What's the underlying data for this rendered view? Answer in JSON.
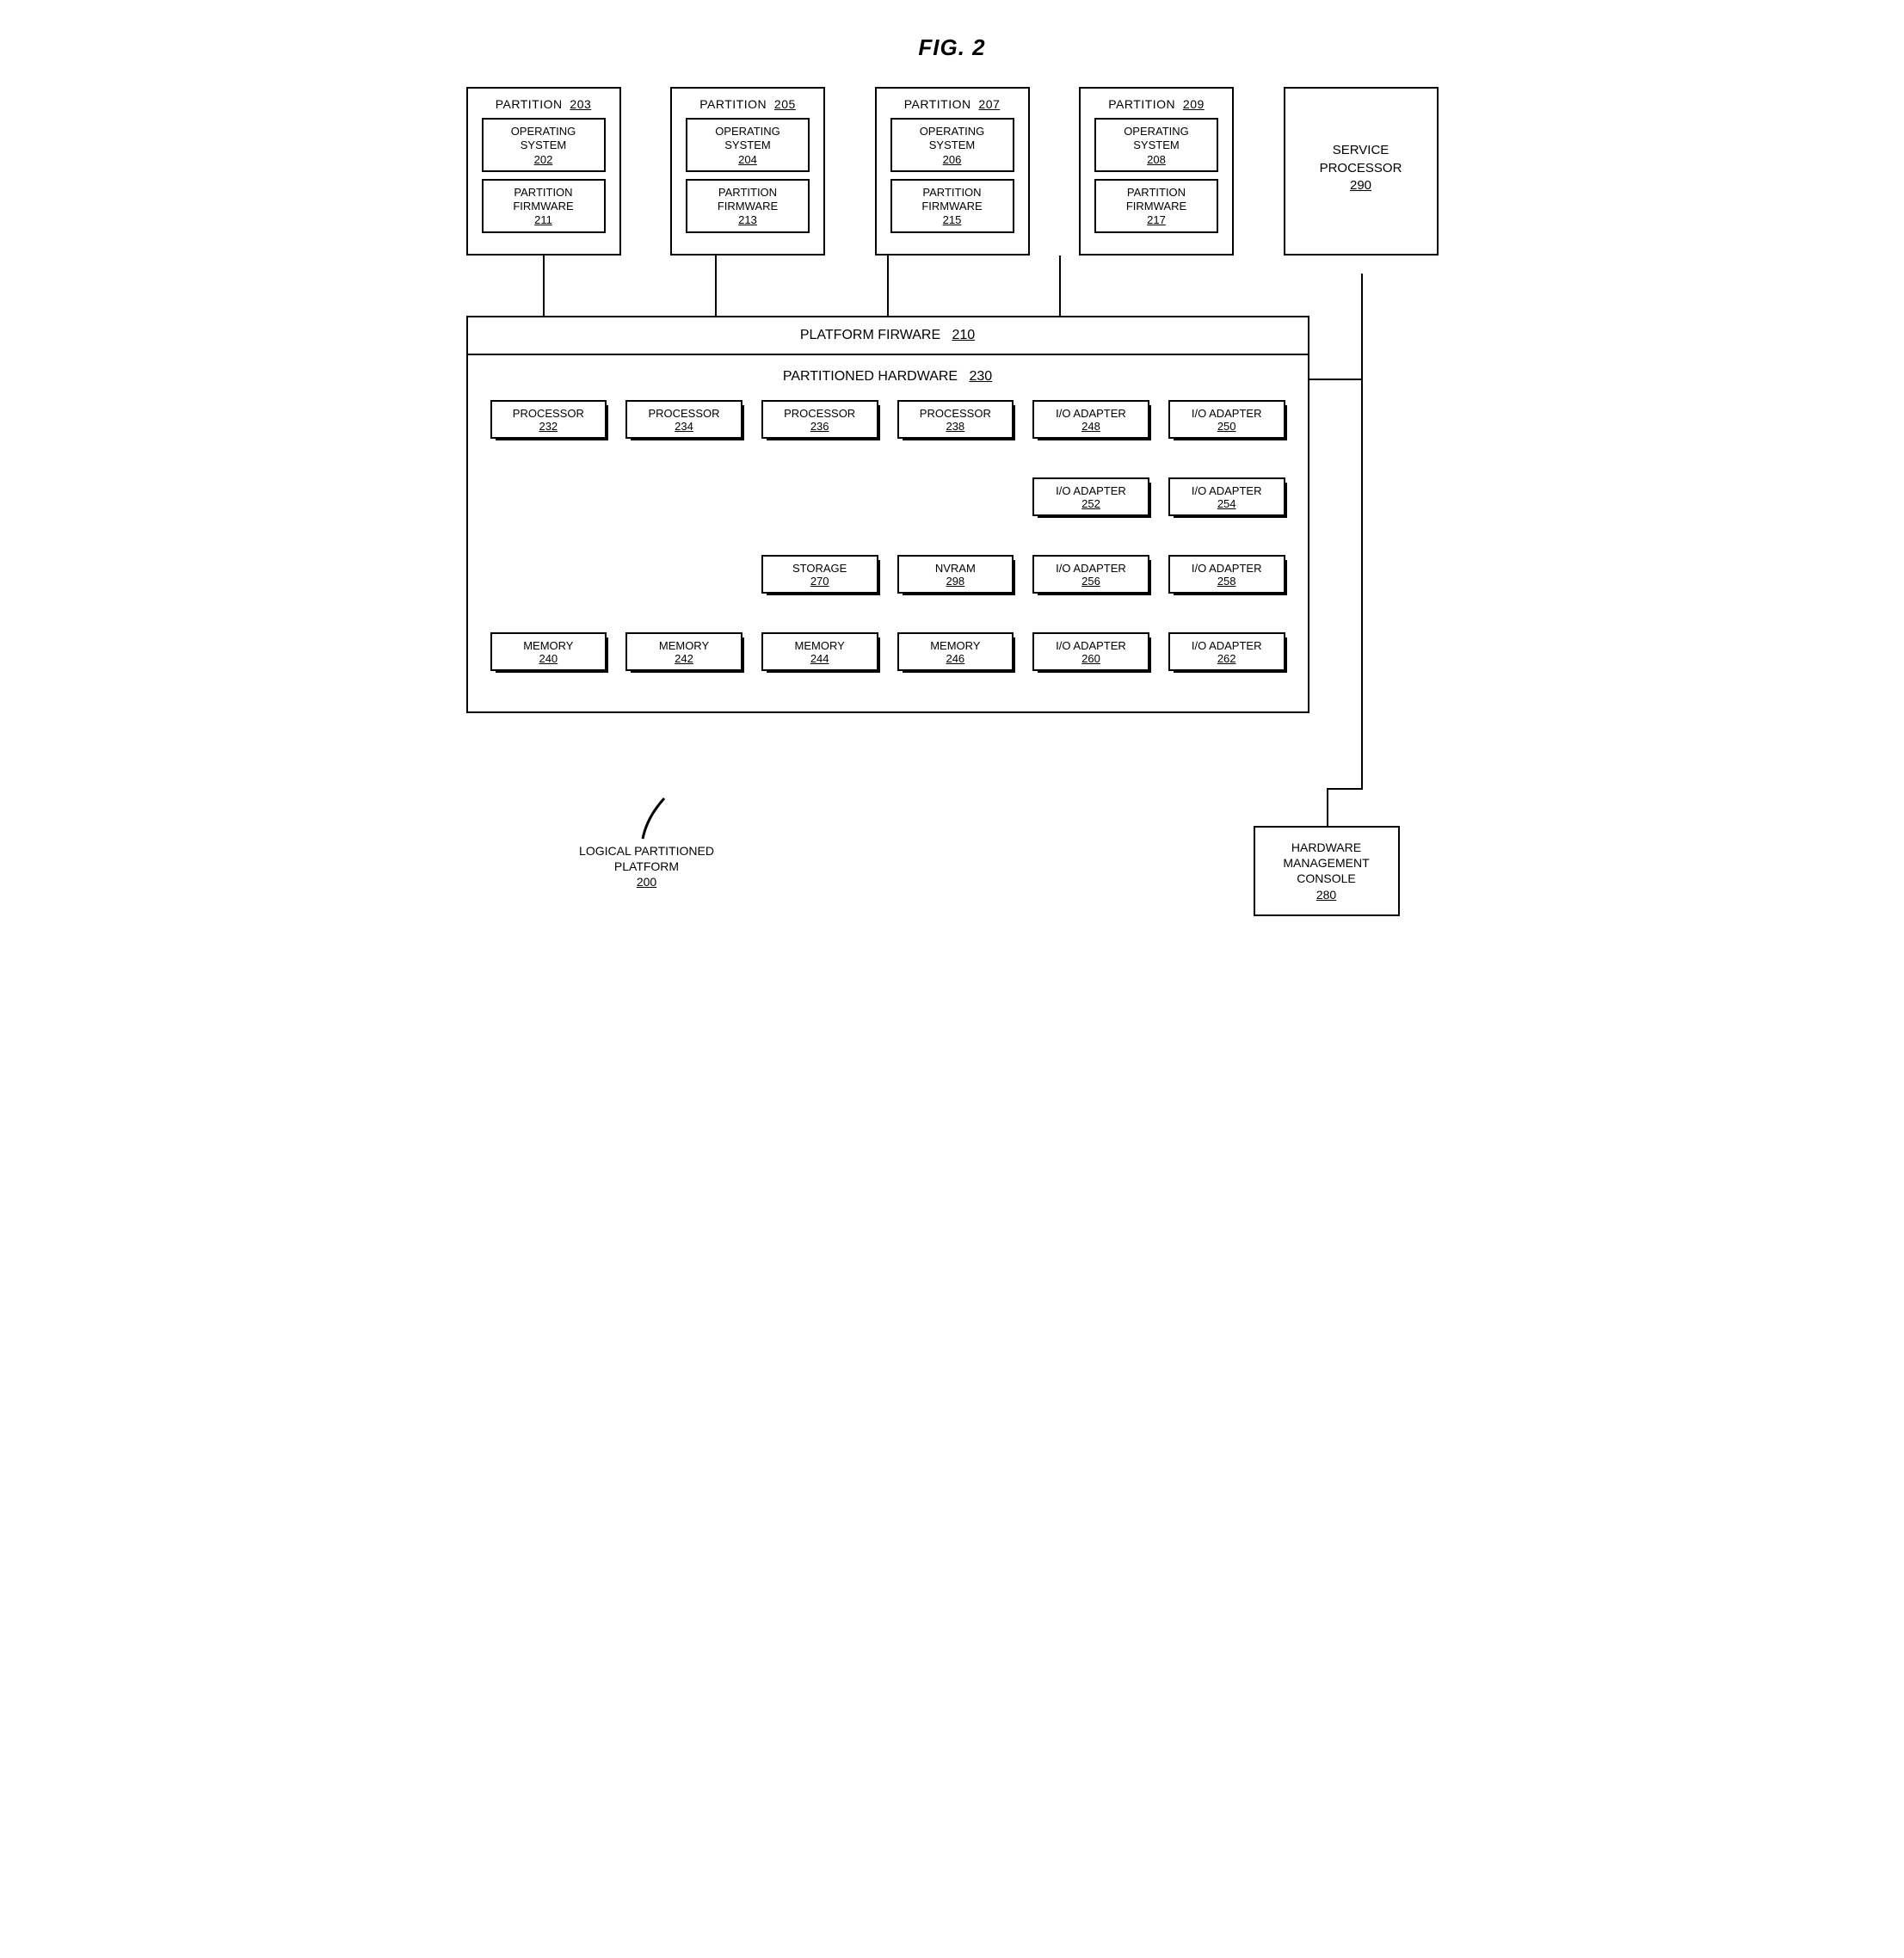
{
  "figure_title": "FIG. 2",
  "partitions": [
    {
      "label": "PARTITION",
      "ref": "203",
      "os": {
        "label": "OPERATING SYSTEM",
        "ref": "202"
      },
      "fw": {
        "label": "PARTITION FIRMWARE",
        "ref": "211"
      }
    },
    {
      "label": "PARTITION",
      "ref": "205",
      "os": {
        "label": "OPERATING SYSTEM",
        "ref": "204"
      },
      "fw": {
        "label": "PARTITION FIRMWARE",
        "ref": "213"
      }
    },
    {
      "label": "PARTITION",
      "ref": "207",
      "os": {
        "label": "OPERATING SYSTEM",
        "ref": "206"
      },
      "fw": {
        "label": "PARTITION FIRMWARE",
        "ref": "215"
      }
    },
    {
      "label": "PARTITION",
      "ref": "209",
      "os": {
        "label": "OPERATING SYSTEM",
        "ref": "208"
      },
      "fw": {
        "label": "PARTITION FIRMWARE",
        "ref": "217"
      }
    }
  ],
  "service_processor": {
    "label": "SERVICE PROCESSOR",
    "ref": "290"
  },
  "platform_firmware": {
    "label": "PLATFORM FIRWARE",
    "ref": "210"
  },
  "partitioned_hardware": {
    "label": "PARTITIONED HARDWARE",
    "ref": "230"
  },
  "hw_grid": [
    [
      {
        "label": "PROCESSOR",
        "ref": "232"
      },
      {
        "label": "PROCESSOR",
        "ref": "234"
      },
      {
        "label": "PROCESSOR",
        "ref": "236"
      },
      {
        "label": "PROCESSOR",
        "ref": "238"
      },
      {
        "label": "I/O ADAPTER",
        "ref": "248"
      },
      {
        "label": "I/O ADAPTER",
        "ref": "250"
      }
    ],
    [
      null,
      null,
      null,
      null,
      {
        "label": "I/O ADAPTER",
        "ref": "252"
      },
      {
        "label": "I/O ADAPTER",
        "ref": "254"
      }
    ],
    [
      null,
      null,
      {
        "label": "STORAGE",
        "ref": "270"
      },
      {
        "label": "NVRAM",
        "ref": "298"
      },
      {
        "label": "I/O ADAPTER",
        "ref": "256"
      },
      {
        "label": "I/O ADAPTER",
        "ref": "258"
      }
    ],
    [
      {
        "label": "MEMORY",
        "ref": "240"
      },
      {
        "label": "MEMORY",
        "ref": "242"
      },
      {
        "label": "MEMORY",
        "ref": "244"
      },
      {
        "label": "MEMORY",
        "ref": "246"
      },
      {
        "label": "I/O ADAPTER",
        "ref": "260"
      },
      {
        "label": "I/O ADAPTER",
        "ref": "262"
      }
    ]
  ],
  "hmc": {
    "label": "HARDWARE MANAGEMENT CONSOLE",
    "ref": "280"
  },
  "platform_label": {
    "label": "LOGICAL PARTITIONED PLATFORM",
    "ref": "200"
  }
}
